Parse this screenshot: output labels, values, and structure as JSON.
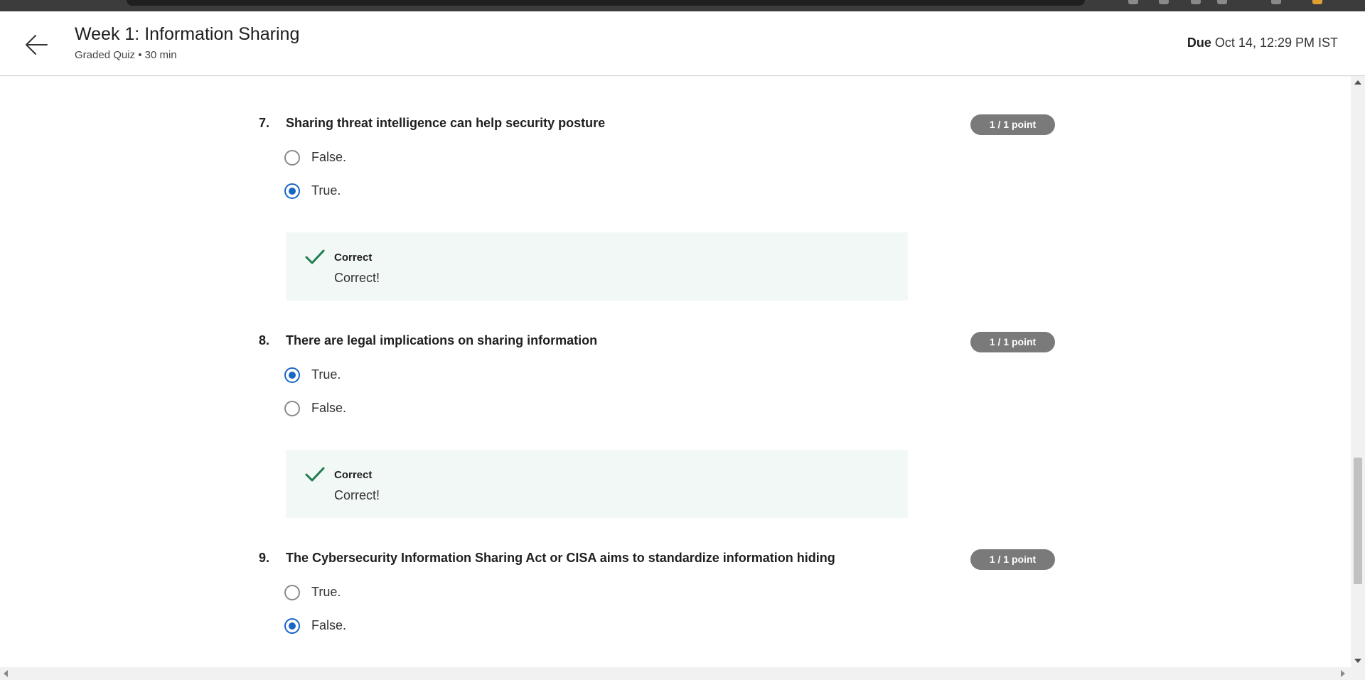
{
  "header": {
    "title": "Week 1: Information Sharing",
    "subtitle": "Graded Quiz • 30 min",
    "due_label": "Due",
    "due_value": "Oct 14, 12:29 PM IST",
    "back_icon": "arrow-left-icon"
  },
  "questions": [
    {
      "number": "7.",
      "text": "Sharing threat intelligence can help security posture",
      "points": "1 / 1 point",
      "options": [
        {
          "label": "False.",
          "selected": false
        },
        {
          "label": "True.",
          "selected": true
        }
      ],
      "feedback": {
        "title": "Correct",
        "text": "Correct!"
      }
    },
    {
      "number": "8.",
      "text": "There are legal implications on sharing information",
      "points": "1 / 1 point",
      "options": [
        {
          "label": "True.",
          "selected": true
        },
        {
          "label": "False.",
          "selected": false
        }
      ],
      "feedback": {
        "title": "Correct",
        "text": "Correct!"
      }
    },
    {
      "number": "9.",
      "text": "The Cybersecurity Information Sharing Act or CISA aims to standardize information hiding",
      "points": "1 / 1 point",
      "options": [
        {
          "label": "True.",
          "selected": false
        },
        {
          "label": "False.",
          "selected": true
        }
      ]
    }
  ],
  "colors": {
    "accent": "#1a66c5",
    "correct": "#1e7d4f",
    "feedback_bg": "#f2f8f5",
    "points_badge": "#7a7a7a"
  }
}
